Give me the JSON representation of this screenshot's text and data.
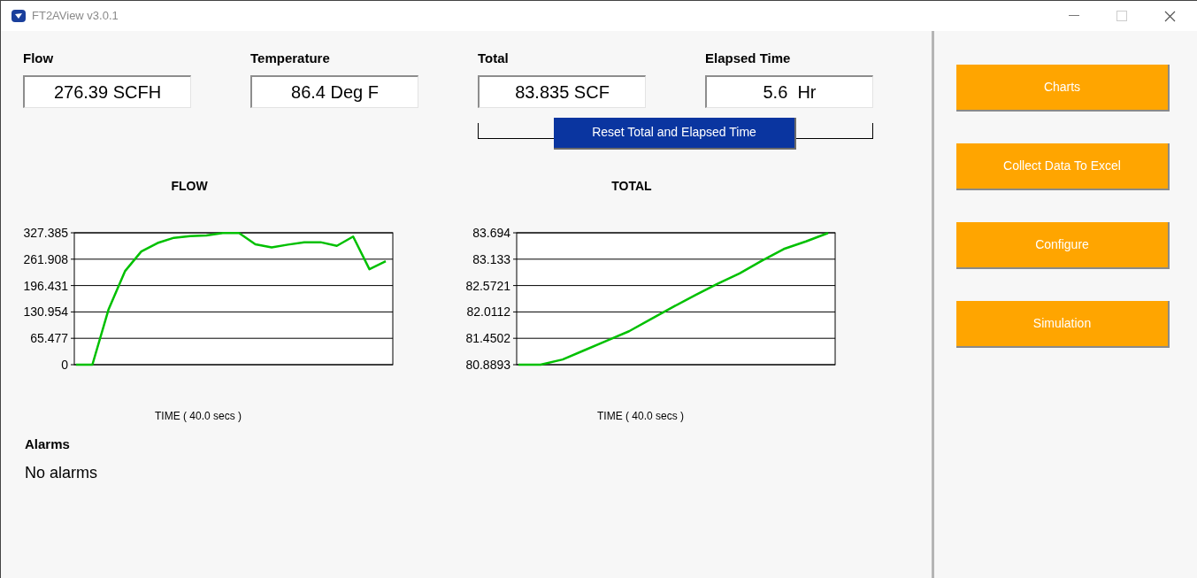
{
  "window": {
    "title": "FT2AView v3.0.1"
  },
  "readings": [
    {
      "label": "Flow",
      "value": "276.39 SCFH"
    },
    {
      "label": "Temperature",
      "value": "86.4 Deg F"
    },
    {
      "label": "Total",
      "value": "83.835 SCF"
    },
    {
      "label": "Elapsed Time",
      "value": "5.6  Hr"
    }
  ],
  "reset_button": "Reset Total and Elapsed Time",
  "charts": [
    {
      "chart_data": {
        "type": "line",
        "title": "FLOW",
        "xlabel": "TIME ( 40.0 secs )",
        "grid": true,
        "series": [
          {
            "color": "#00c000",
            "values": [
              0,
              0,
              138,
              232,
              281,
              302,
              315,
              319,
              321,
              327,
              327,
              299,
              291,
              298,
              304,
              304,
              295,
              318,
              237,
              257
            ]
          }
        ],
        "ylim": [
          0,
          327.385
        ],
        "yticks": [
          0,
          {
            "value": 65.477,
            "label": "65.477"
          },
          {
            "value": 130.954,
            "label": "130.954"
          },
          {
            "value": 196.431,
            "label": "196.431"
          },
          {
            "value": 261.908,
            "label": "261.908"
          },
          {
            "value": 327.385,
            "label": "327.385"
          }
        ]
      }
    },
    {
      "chart_data": {
        "type": "line",
        "title": "TOTAL",
        "xlabel": "TIME ( 40.0 secs )",
        "grid": true,
        "series": [
          {
            "color": "#00c000",
            "values": [
              80.89,
              80.89,
              81.0,
              81.2,
              81.4,
              81.6,
              81.86,
              82.12,
              82.37,
              82.61,
              82.83,
              83.1,
              83.35,
              83.51,
              83.69
            ]
          }
        ],
        "ylim": [
          80.8893,
          83.694
        ],
        "yticks": [
          {
            "value": 80.8893,
            "label": "80.8893"
          },
          {
            "value": 81.4502,
            "label": "81.4502"
          },
          {
            "value": 82.0112,
            "label": "82.0112"
          },
          {
            "value": 82.5721,
            "label": "82.5721"
          },
          {
            "value": 83.133,
            "label": "83.133"
          },
          {
            "value": 83.694,
            "label": "83.694"
          }
        ]
      }
    }
  ],
  "alarms": {
    "title": "Alarms",
    "text": "No alarms"
  },
  "side_buttons": [
    "Charts",
    "Collect Data To Excel",
    "Configure",
    "Simulation"
  ]
}
